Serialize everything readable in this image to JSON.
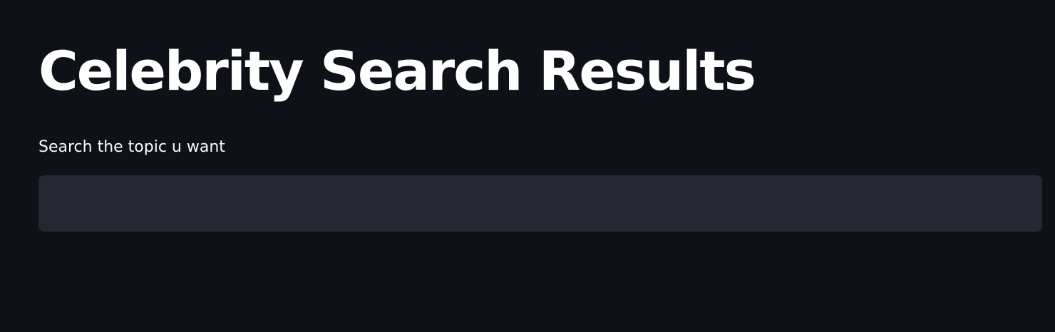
{
  "page": {
    "title": "Celebrity Search Results"
  },
  "search": {
    "label": "Search the topic u want",
    "value": "",
    "placeholder": ""
  },
  "colors": {
    "background": "#0e1117",
    "text": "#ffffff",
    "input_background": "#262730"
  }
}
